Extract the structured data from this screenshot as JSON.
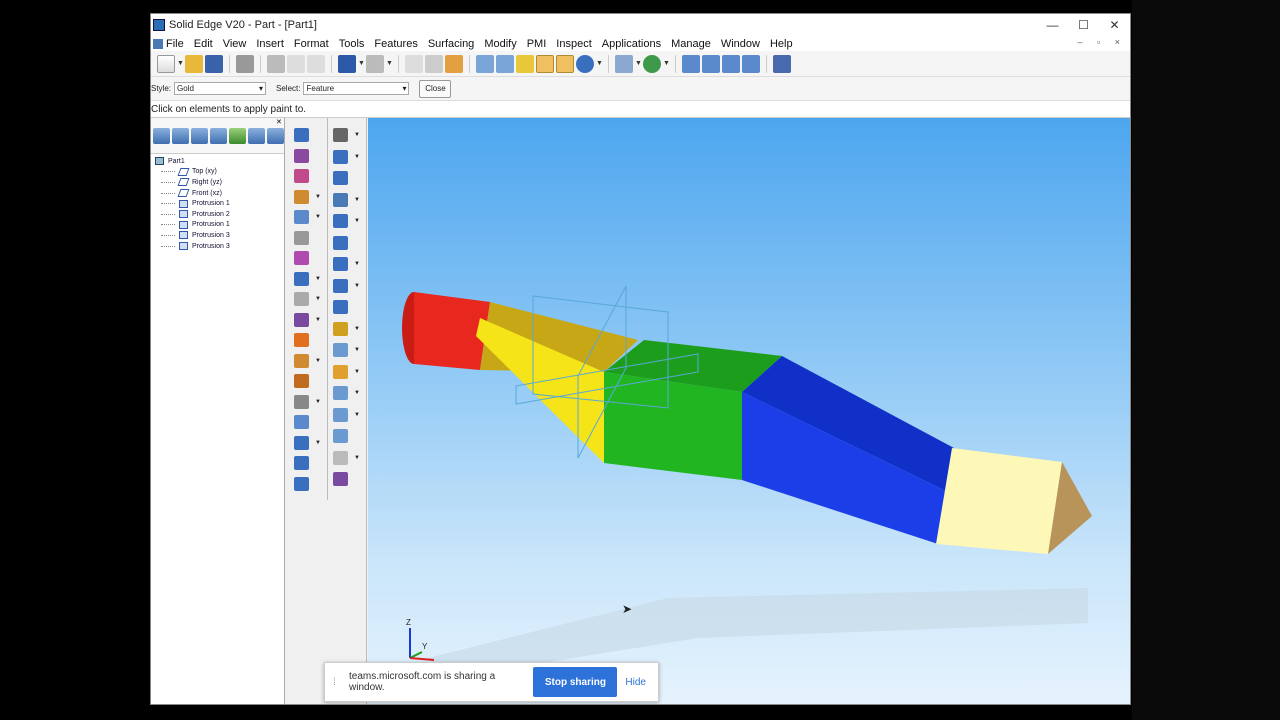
{
  "window": {
    "title": "Solid Edge V20 - Part - [Part1]",
    "controls": {
      "minimize": "—",
      "maximize": "☐",
      "close": "✕"
    }
  },
  "menu": {
    "items": [
      "File",
      "Edit",
      "View",
      "Insert",
      "Format",
      "Tools",
      "Features",
      "Surfacing",
      "Modify",
      "PMI",
      "Inspect",
      "Applications",
      "Manage",
      "Window",
      "Help"
    ],
    "mdi_controls": "– ▫ ×"
  },
  "ribbon": {
    "style_label": "Style:",
    "style_value": "Gold",
    "select_label": "Select:",
    "select_value": "Feature",
    "close_label": "Close"
  },
  "prompt": "Click on elements to apply paint to.",
  "tree": {
    "root": "Part1",
    "items": [
      {
        "label": "Top (xy)",
        "icon": "plane-icon"
      },
      {
        "label": "Right (yz)",
        "icon": "plane-icon"
      },
      {
        "label": "Front (xz)",
        "icon": "plane-icon"
      },
      {
        "label": "Protrusion 1",
        "icon": "protrusion-icon"
      },
      {
        "label": "Protrusion 2",
        "icon": "protrusion-icon"
      },
      {
        "label": "Protrusion 1",
        "icon": "protrusion-icon"
      },
      {
        "label": "Protrusion 3",
        "icon": "protrusion-icon"
      },
      {
        "label": "Protrusion 3",
        "icon": "protrusion-icon"
      }
    ]
  },
  "triad": {
    "z": "Z",
    "y": "Y"
  },
  "share_bar": {
    "message": "teams.microsoft.com is sharing a window.",
    "stop_label": "Stop sharing",
    "hide_label": "Hide"
  },
  "colors": {
    "red": "#e8281e",
    "yellow": "#f5e418",
    "green": "#22b522",
    "blue": "#1c3ee8",
    "cream": "#fdf7b8",
    "tan": "#b8945a"
  }
}
